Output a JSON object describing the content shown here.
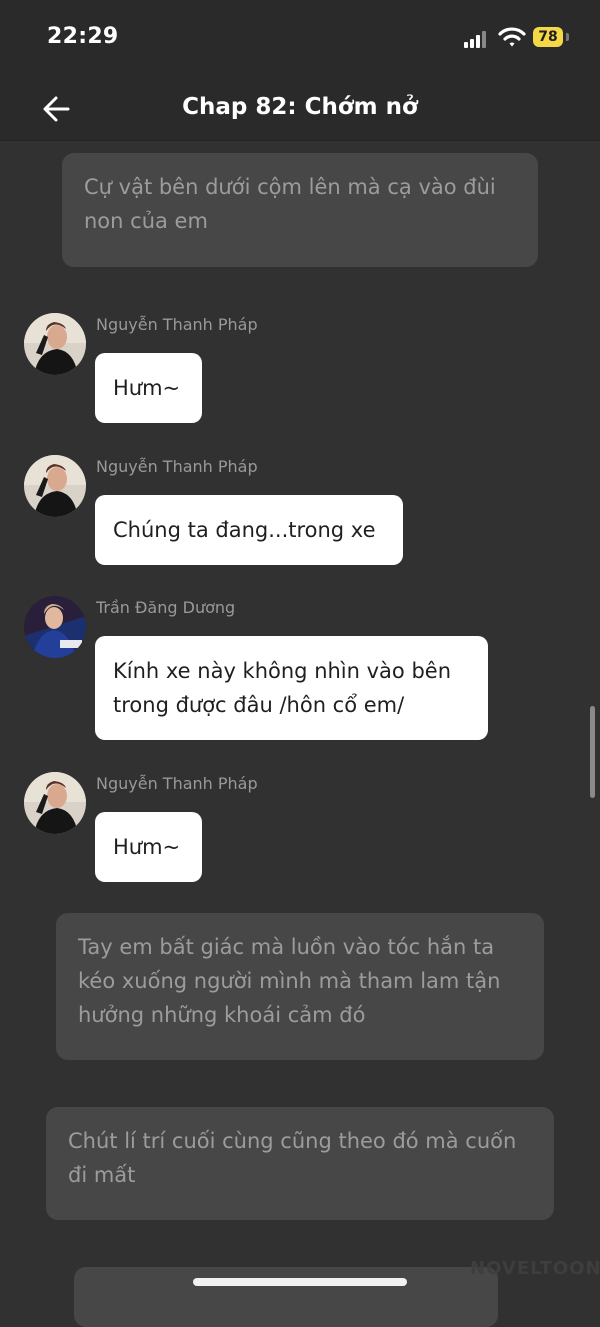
{
  "status_bar": {
    "time": "22:29",
    "battery": "78"
  },
  "header": {
    "title": "Chap 82: Chớm nở"
  },
  "narrations": [
    "Cự vật bên dưới cộm lên mà cạ vào đùi non của em",
    "Tay em bất giác mà luồn vào tóc hắn ta kéo xuống người mình mà tham lam tận hưởng những khoái cảm đó",
    "Chút lí trí cuối cùng cũng theo đó mà cuốn đi mất"
  ],
  "messages": [
    {
      "speaker": "Nguyễn Thanh Pháp",
      "text": "Hưm~",
      "avatar": "phap"
    },
    {
      "speaker": "Nguyễn Thanh Pháp",
      "text": "Chúng ta đang...trong xe",
      "avatar": "phap"
    },
    {
      "speaker": "Trần Đăng Dương",
      "text": "Kính xe này không nhìn vào bên trong được đâu /hôn cổ em/",
      "avatar": "duong"
    },
    {
      "speaker": "Nguyễn Thanh Pháp",
      "text": "Hưm~",
      "avatar": "phap"
    }
  ],
  "watermark": "NOVELTOON",
  "colors": {
    "background": "#313131",
    "header": "#2a2a2a",
    "narration_bg": "#474747",
    "bubble_bg": "#ffffff",
    "battery": "#f5d845"
  },
  "icons": [
    "back-arrow-icon",
    "cellular-signal-icon",
    "wifi-icon",
    "battery-icon"
  ]
}
